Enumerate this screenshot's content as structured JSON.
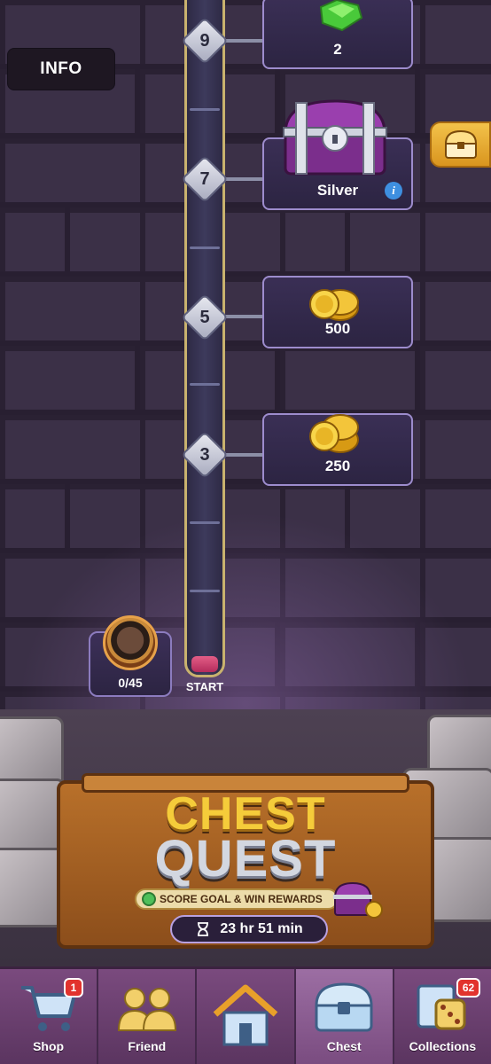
{
  "header": {
    "info_label": "INFO"
  },
  "track": {
    "start_label": "START",
    "milestones": [
      {
        "step": "9",
        "reward": "2",
        "reward_type": "gem"
      },
      {
        "step": "7",
        "reward": "Silver",
        "reward_type": "chest"
      },
      {
        "step": "5",
        "reward": "500",
        "reward_type": "coins"
      },
      {
        "step": "3",
        "reward": "250",
        "reward_type": "coins"
      }
    ]
  },
  "player": {
    "score": "0/45"
  },
  "event": {
    "title_line1": "CHEST",
    "title_line2": "QUEST",
    "subtitle": "SCORE GOAL & WIN REWARDS",
    "timer": "23 hr 51 min"
  },
  "nav": {
    "items": [
      {
        "label": "Shop",
        "badge": "1"
      },
      {
        "label": "Friend",
        "badge": ""
      },
      {
        "label": "",
        "badge": ""
      },
      {
        "label": "Chest",
        "badge": ""
      },
      {
        "label": "Collections",
        "badge": "62"
      }
    ]
  },
  "colors": {
    "wall": "#3b3047",
    "track_border": "#c9b26e",
    "progress_fill": "#e35d86",
    "reward_border": "#9d8ccd",
    "nav_bg": "#7a4a7e",
    "badge": "#e2332d"
  }
}
